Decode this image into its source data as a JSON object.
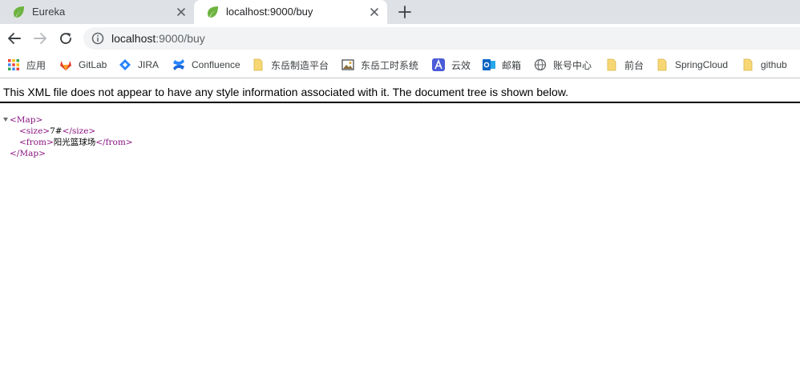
{
  "tabs": [
    {
      "title": "Eureka",
      "active": false
    },
    {
      "title": "localhost:9000/buy",
      "active": true
    }
  ],
  "toolbar": {
    "url_host": "localhost",
    "url_path": ":9000/buy"
  },
  "bookmarks": [
    {
      "label": "应用",
      "icon": "apps-grid-icon"
    },
    {
      "label": "GitLab",
      "icon": "gitlab-icon"
    },
    {
      "label": "JIRA",
      "icon": "jira-icon"
    },
    {
      "label": "Confluence",
      "icon": "confluence-icon"
    },
    {
      "label": "东岳制造平台",
      "icon": "folder-icon"
    },
    {
      "label": "东岳工时系统",
      "icon": "image-icon"
    },
    {
      "label": "云效",
      "icon": "yunxiao-icon"
    },
    {
      "label": "邮箱",
      "icon": "outlook-icon"
    },
    {
      "label": "账号中心",
      "icon": "globe-icon"
    },
    {
      "label": "前台",
      "icon": "folder-icon"
    },
    {
      "label": "SpringCloud",
      "icon": "folder-icon"
    },
    {
      "label": "github",
      "icon": "folder-icon"
    }
  ],
  "content": {
    "notice": "This XML file does not appear to have any style information associated with it. The document tree is shown below.",
    "xml": {
      "root_open": "<Map>",
      "size_open": "<size>",
      "size_value": "7#",
      "size_close": "</size>",
      "from_open": "<from>",
      "from_value": "阳光篮球场",
      "from_close": "</from>",
      "root_close": "</Map>"
    }
  },
  "colors": {
    "tabstrip": "#dee1e6",
    "xml_tag": "#881280",
    "spring_green": "#6db33f"
  }
}
